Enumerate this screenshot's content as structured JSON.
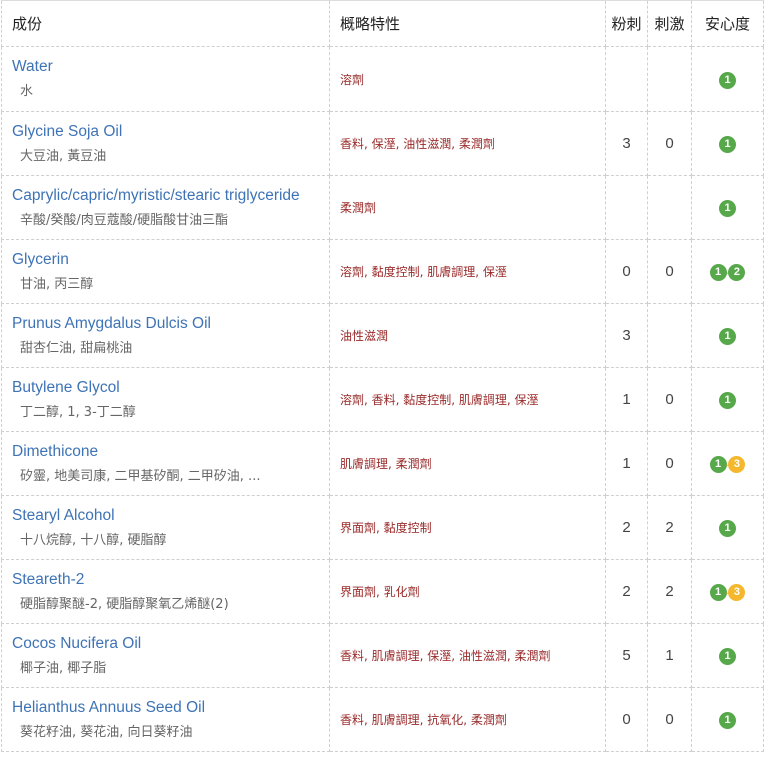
{
  "headers": {
    "ingredient": "成份",
    "features": "概略特性",
    "acne": "粉刺",
    "irritation": "刺激",
    "safety": "安心度"
  },
  "rows": [
    {
      "en": "Water",
      "zh": "水",
      "features": "溶劑",
      "acne": "",
      "irritation": "",
      "safety": [
        "1"
      ],
      "safety_colors": [
        "green"
      ]
    },
    {
      "en": "Glycine Soja Oil",
      "zh": "大豆油, 黃豆油",
      "features": "香料, 保溼, 油性滋潤, 柔潤劑",
      "acne": "3",
      "irritation": "0",
      "safety": [
        "1"
      ],
      "safety_colors": [
        "green"
      ]
    },
    {
      "en": "Caprylic/capric/myristic/stearic triglyceride",
      "zh": "辛酸/癸酸/肉豆蔻酸/硬脂酸甘油三酯",
      "features": "柔潤劑",
      "acne": "",
      "irritation": "",
      "safety": [
        "1"
      ],
      "safety_colors": [
        "green"
      ]
    },
    {
      "en": "Glycerin",
      "zh": "甘油, 丙三醇",
      "features": "溶劑, 黏度控制, 肌膚調理, 保溼",
      "acne": "0",
      "irritation": "0",
      "safety": [
        "1",
        "2"
      ],
      "safety_colors": [
        "green",
        "green"
      ]
    },
    {
      "en": "Prunus Amygdalus Dulcis Oil",
      "zh": "甜杏仁油, 甜扁桃油",
      "features": "油性滋潤",
      "acne": "3",
      "irritation": "",
      "safety": [
        "1"
      ],
      "safety_colors": [
        "green"
      ]
    },
    {
      "en": "Butylene Glycol",
      "zh": "丁二醇, 1, 3-丁二醇",
      "features": "溶劑, 香料, 黏度控制, 肌膚調理, 保溼",
      "acne": "1",
      "irritation": "0",
      "safety": [
        "1"
      ],
      "safety_colors": [
        "green"
      ]
    },
    {
      "en": "Dimethicone",
      "zh": "矽靈, 地美司康, 二甲基矽酮, 二甲矽油, ...",
      "features": "肌膚調理, 柔潤劑",
      "acne": "1",
      "irritation": "0",
      "safety": [
        "1",
        "3"
      ],
      "safety_colors": [
        "green",
        "yellow"
      ]
    },
    {
      "en": "Stearyl Alcohol",
      "zh": "十八烷醇, 十八醇, 硬脂醇",
      "features": "界面劑, 黏度控制",
      "acne": "2",
      "irritation": "2",
      "safety": [
        "1"
      ],
      "safety_colors": [
        "green"
      ]
    },
    {
      "en": "Steareth-2",
      "zh": "硬脂醇聚醚-2, 硬脂醇聚氧乙烯醚(2)",
      "features": "界面劑, 乳化劑",
      "acne": "2",
      "irritation": "2",
      "safety": [
        "1",
        "3"
      ],
      "safety_colors": [
        "green",
        "yellow"
      ]
    },
    {
      "en": "Cocos Nucifera Oil",
      "zh": "椰子油, 椰子脂",
      "features": "香料, 肌膚調理, 保溼, 油性滋潤, 柔潤劑",
      "acne": "5",
      "irritation": "1",
      "safety": [
        "1"
      ],
      "safety_colors": [
        "green"
      ]
    },
    {
      "en": "Helianthus Annuus Seed Oil",
      "zh": "葵花籽油, 葵花油, 向日葵籽油",
      "features": "香料, 肌膚調理, 抗氧化, 柔潤劑",
      "acne": "0",
      "irritation": "0",
      "safety": [
        "1"
      ],
      "safety_colors": [
        "green"
      ]
    }
  ]
}
